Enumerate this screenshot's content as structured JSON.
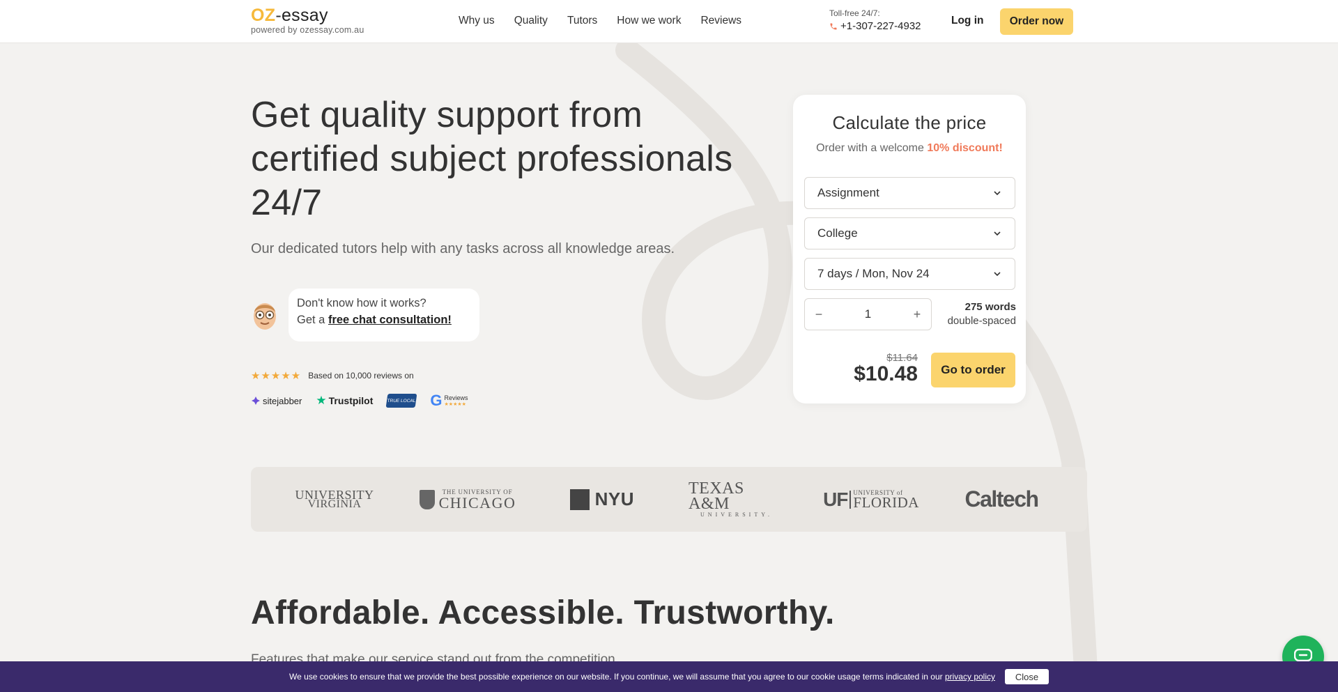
{
  "header": {
    "logo_oz": "OZ",
    "logo_dash": "-",
    "logo_essay": "essay",
    "logo_sub": "powered by ozessay.com.au",
    "nav": [
      "Why us",
      "Quality",
      "Tutors",
      "How we work",
      "Reviews"
    ],
    "tollfree_label": "Toll-free 24/7:",
    "phone": "+1-307-227-4932",
    "login": "Log in",
    "order_now": "Order now"
  },
  "hero": {
    "title": "Get quality support from certified subject professionals 24/7",
    "subtitle": "Our dedicated tutors help with any tasks across all knowledge areas.",
    "consult_line1": "Don't know how it works?",
    "consult_prefix": "Get a ",
    "consult_link": "free chat consultation!",
    "stars": "★★★★★",
    "based_on": "Based on 10,000 reviews on",
    "badges": {
      "sitejabber": "sitejabber",
      "trustpilot": "Trustpilot",
      "truelocal": "TRUE LOCAL",
      "google_reviews": "Reviews"
    }
  },
  "calculator": {
    "title": "Calculate the price",
    "sub_prefix": "Order with a welcome ",
    "discount": "10% discount!",
    "type": "Assignment",
    "level": "College",
    "deadline": "7 days / Mon, Nov 24",
    "pages": "1",
    "minus": "−",
    "plus": "+",
    "words": "275 words",
    "spacing": "double-spaced",
    "old_price": "$11.64",
    "new_price": "$10.48",
    "go_order": "Go to order"
  },
  "universities": {
    "virginia_1": "UNIVERSITY",
    "virginia_2": "VIRGINIA",
    "chicago_1": "THE UNIVERSITY OF",
    "chicago_2": "CHICAGO",
    "nyu": "NYU",
    "texas_1": "TEXAS A&M",
    "texas_2": "UNIVERSITY.",
    "uf": "UF",
    "florida_1": "UNIVERSITY of",
    "florida_2": "FLORIDA",
    "caltech": "Caltech"
  },
  "section": {
    "title": "Affordable. Accessible. Trustworthy.",
    "subtitle": "Features that make our service stand out from the competition"
  },
  "cookie": {
    "text": "We use cookies to ensure that we provide the best possible experience on our website. If you continue, we will assume that you agree to our cookie usage terms indicated in our ",
    "link": "privacy policy",
    "close": "Close"
  },
  "colors": {
    "accent_yellow": "#fbd46d",
    "discount_orange": "#f07a5a",
    "cookie_bar": "#3a2a6b",
    "chat_green": "#1fb35b"
  },
  "icons": [
    "phone-icon",
    "chevron-down-icon",
    "chat-icon",
    "star-icon"
  ]
}
